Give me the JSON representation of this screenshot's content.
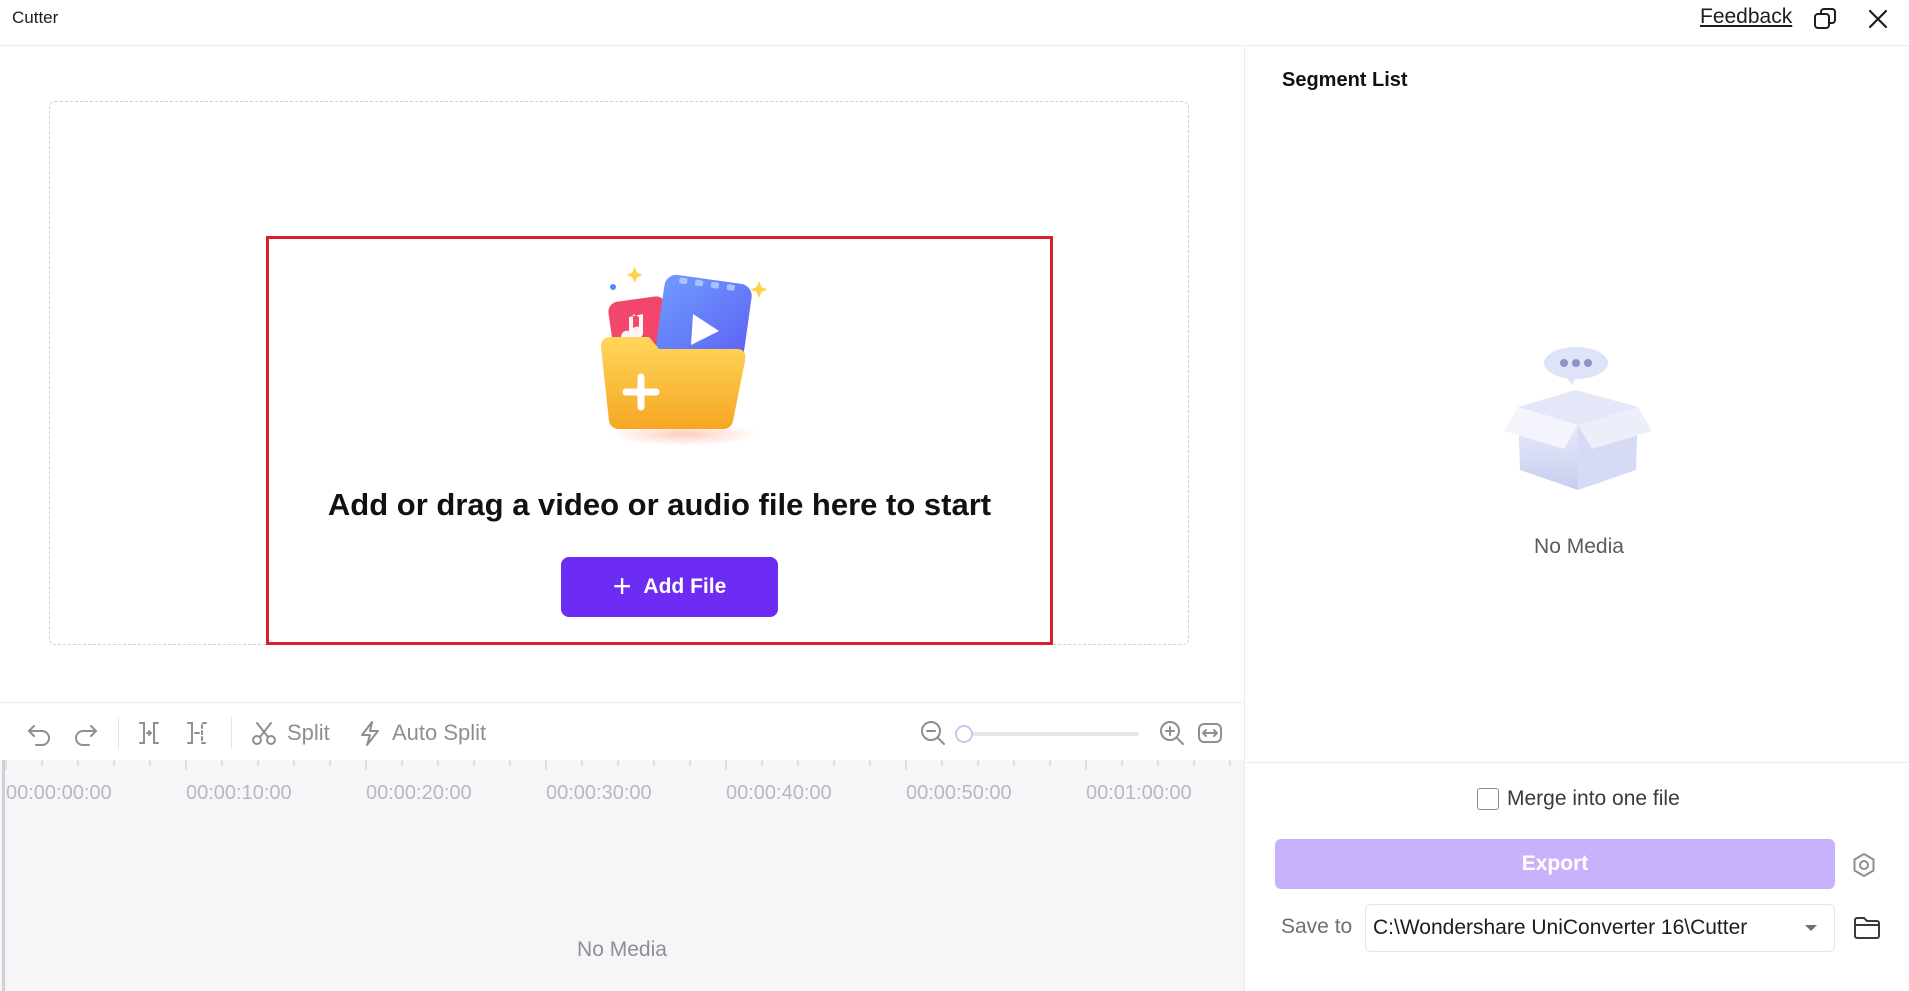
{
  "window": {
    "title": "Cutter",
    "feedback_label": "Feedback",
    "restore_icon": "restore-window-icon",
    "close_icon": "close-icon"
  },
  "dropzone": {
    "message": "Add or drag a video or audio file here to start",
    "add_file_label": "Add File",
    "illustration_icon": "media-folder-add-icon"
  },
  "toolbar": {
    "undo_icon": "undo-icon",
    "redo_icon": "redo-icon",
    "mark_in_icon": "mark-in-icon",
    "mark_out_icon": "mark-out-icon",
    "split_label": "Split",
    "auto_split_label": "Auto Split",
    "zoom_level": 0
  },
  "timeline": {
    "ticks": [
      "00:00:00:00",
      "00:00:10:00",
      "00:00:20:00",
      "00:00:30:00",
      "00:00:40:00",
      "00:00:50:00",
      "00:01:00:00"
    ],
    "empty_text": "No Media"
  },
  "segment_panel": {
    "title": "Segment List",
    "empty_text": "No Media"
  },
  "export": {
    "merge_label": "Merge into one file",
    "merge_checked": false,
    "export_label": "Export",
    "save_to_label": "Save to",
    "save_path": "C:\\Wondershare UniConverter 16\\Cutter"
  },
  "colors": {
    "accent": "#6c2cf3",
    "export_disabled": "#c7b2fb",
    "highlight_border": "#d9202a"
  }
}
